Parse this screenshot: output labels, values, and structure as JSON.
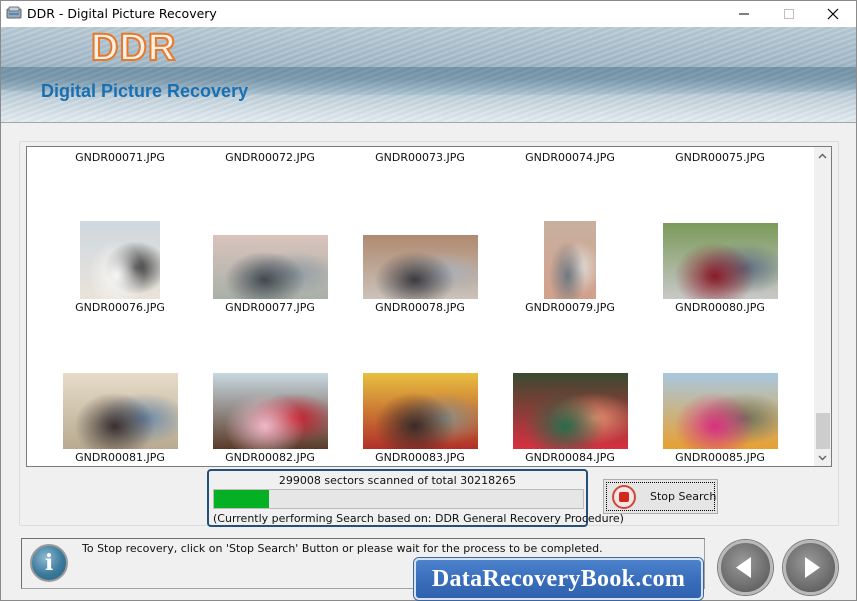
{
  "window": {
    "title": "DDR - Digital Picture Recovery",
    "controls": {
      "minimize": "minimize",
      "maximize": "maximize",
      "close": "close"
    }
  },
  "banner": {
    "logo": "DDR",
    "subtitle": "Digital Picture Recovery"
  },
  "gallery": {
    "rows": [
      {
        "items": [
          {
            "name": "GNDR00071.JPG"
          },
          {
            "name": "GNDR00072.JPG"
          },
          {
            "name": "GNDR00073.JPG"
          },
          {
            "name": "GNDR00074.JPG"
          },
          {
            "name": "GNDR00075.JPG"
          }
        ]
      },
      {
        "items": [
          {
            "name": "GNDR00076.JPG",
            "thumb_colors": [
              "#cfd8df",
              "#e9e3da",
              "#f7f7f7",
              "#2e2e2e"
            ]
          },
          {
            "name": "GNDR00077.JPG",
            "thumb_colors": [
              "#d9c4bd",
              "#a8b0a8",
              "#404850",
              "#8f9aa3"
            ]
          },
          {
            "name": "GNDR00078.JPG",
            "thumb_colors": [
              "#b08a70",
              "#cac2ba",
              "#3a3a40",
              "#a8b0b8"
            ]
          },
          {
            "name": "GNDR00079.JPG",
            "thumb_colors": [
              "#c8b0a0",
              "#d2a08a",
              "#707880",
              "#e0dcd8"
            ]
          },
          {
            "name": "GNDR00080.JPG",
            "thumb_colors": [
              "#7a9a5a",
              "#c8c8c8",
              "#8a1a28",
              "#5a6a80"
            ]
          }
        ]
      },
      {
        "items": [
          {
            "name": "GNDR00081.JPG",
            "thumb_colors": [
              "#e6dcc8",
              "#b8aa90",
              "#3a3030",
              "#6a88a8"
            ]
          },
          {
            "name": "GNDR00082.JPG",
            "thumb_colors": [
              "#c8d8e0",
              "#5a3a28",
              "#f0b8c8",
              "#c81a2a"
            ]
          },
          {
            "name": "GNDR00083.JPG",
            "thumb_colors": [
              "#e8c040",
              "#b03028",
              "#3a2a28",
              "#8a9088"
            ]
          },
          {
            "name": "GNDR00084.JPG",
            "thumb_colors": [
              "#3a4a30",
              "#d83040",
              "#2a6a4a",
              "#e89070"
            ]
          },
          {
            "name": "GNDR00085.JPG",
            "thumb_colors": [
              "#a8c8e0",
              "#e8a030",
              "#d83080",
              "#6a7058"
            ]
          }
        ]
      }
    ],
    "scrollbar": {
      "up": "scroll-up",
      "down": "scroll-down",
      "position_fraction": 0.92
    }
  },
  "progress": {
    "sectors_text": "299008 sectors scanned of total 30218265",
    "scanned": 299008,
    "total": 30218265,
    "fill_percent": 15,
    "fill_color": "#06b025",
    "procedure_text": "(Currently performing Search based on:  DDR General Recovery Procedure)"
  },
  "stop_button": {
    "label": "Stop Search"
  },
  "status": {
    "message": "To Stop recovery, click on 'Stop Search' Button or please wait for the process to be completed."
  },
  "brand": {
    "text": "DataRecoveryBook.com"
  },
  "nav": {
    "back": "back",
    "next": "next"
  }
}
